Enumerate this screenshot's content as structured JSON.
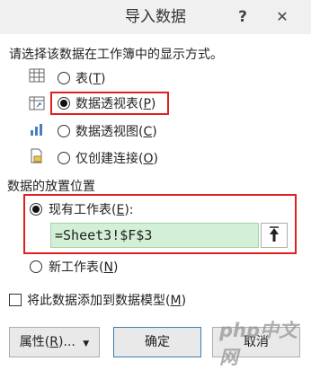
{
  "dialog": {
    "title": "导入数据",
    "help_label": "?",
    "close_label": "✕"
  },
  "display": {
    "prompt": "请选择该数据在工作簿中的显示方式。",
    "options": [
      {
        "label": "表(",
        "key": "T",
        "tail": ")",
        "icon": "table-icon",
        "selected": false
      },
      {
        "label": "数据透视表(",
        "key": "P",
        "tail": ")",
        "icon": "pivot-table-icon",
        "selected": true
      },
      {
        "label": "数据透视图(",
        "key": "C",
        "tail": ")",
        "icon": "pivot-chart-icon",
        "selected": false
      },
      {
        "label": "仅创建连接(",
        "key": "O",
        "tail": ")",
        "icon": "connection-only-icon",
        "selected": false
      }
    ]
  },
  "placement": {
    "heading": "数据的放置位置",
    "existing": {
      "label": "现有工作表(",
      "key": "E",
      "tail": "):",
      "selected": true
    },
    "reference": "=Sheet3!$F$3",
    "new_sheet": {
      "label": "新工作表(",
      "key": "N",
      "tail": ")",
      "selected": false
    }
  },
  "data_model": {
    "label": "将此数据添加到数据模型(",
    "key": "M",
    "tail": ")",
    "checked": false
  },
  "buttons": {
    "properties": {
      "label": "属性(",
      "key": "R",
      "tail": ")...",
      "arrow": "▼"
    },
    "ok": "确定",
    "cancel": "取消"
  },
  "watermark": "php中文网",
  "colors": {
    "highlight_border": "#e02020",
    "reference_fill": "#d3efd6"
  }
}
